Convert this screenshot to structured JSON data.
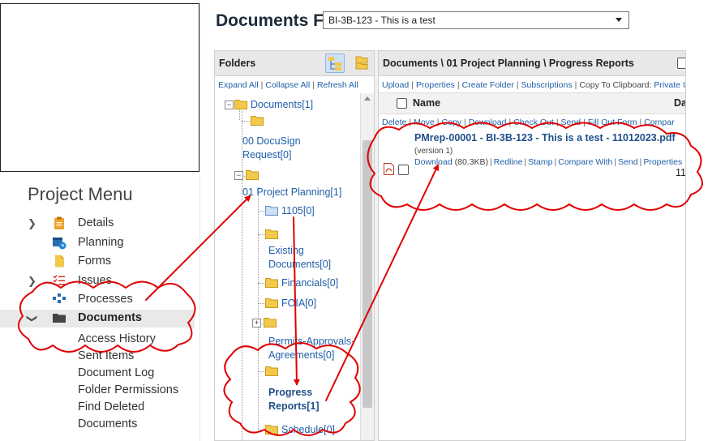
{
  "sidebar": {
    "title": "Project Menu",
    "items": [
      {
        "label": "Details",
        "has_chevron": true,
        "icon": "clipboard-icon"
      },
      {
        "label": "Planning",
        "has_chevron": false,
        "icon": "calendar-clock-icon"
      },
      {
        "label": "Forms",
        "has_chevron": false,
        "icon": "form-icon"
      },
      {
        "label": "Issues",
        "has_chevron": true,
        "icon": "checklist-icon"
      },
      {
        "label": "Processes",
        "has_chevron": false,
        "icon": "process-icon"
      },
      {
        "label": "Documents",
        "has_chevron": true,
        "icon": "folder-icon",
        "active": true
      }
    ],
    "sub_items": [
      "Access History",
      "Sent Items",
      "Document Log",
      "Folder Permissions",
      "Find Deleted",
      "Documents"
    ]
  },
  "header": {
    "documents_for_label": "Documents For",
    "project_select_value": "BI-3B-123 - This is a test"
  },
  "folders_pane": {
    "title": "Folders",
    "expand_all": "Expand All",
    "collapse_all": "Collapse All",
    "refresh_all": "Refresh All",
    "separator": "|",
    "tree": {
      "root": "Documents[1]",
      "docusign_line1": "00 DocuSign",
      "docusign_line2": "Request[0]",
      "project_planning": "01 Project Planning[1]",
      "f1105": "1105[0]",
      "existing_line1": "Existing",
      "existing_line2": "Documents[0]",
      "financials": "Financials[0]",
      "foia": "FOIA[0]",
      "permits_line1": "Permits-Approvals-",
      "permits_line2": "Agreements[0]",
      "progress_line1": "Progress",
      "progress_line2": "Reports[1]",
      "schedule": "Schedule[0]"
    }
  },
  "documents_pane": {
    "breadcrumb": "Documents \\ 01 Project Planning \\ Progress Reports",
    "toolbar1": {
      "upload": "Upload",
      "properties": "Properties",
      "create_folder": "Create Folder",
      "subscriptions": "Subscriptions",
      "copy_to_clipboard": "Copy To Clipboard:",
      "private": "Private U"
    },
    "columns": {
      "name": "Name",
      "date": "Da"
    },
    "toolbar2": {
      "delete": "Delete",
      "move": "Move",
      "copy": "Copy",
      "download": "Download",
      "check_out": "Check Out",
      "send": "Send",
      "fill_out_form": "Fill Out Form",
      "compare": "Compar"
    },
    "file": {
      "title": "PMrep-00001 - BI-3B-123 - This is a test - 11012023.pdf",
      "version": "(version 1)",
      "download": "Download",
      "size": "(80.3KB)",
      "redline": "Redline",
      "stamp": "Stamp",
      "compare_with": "Compare With",
      "send": "Send",
      "properties": "Properties",
      "date": "11."
    }
  },
  "colors": {
    "link": "#1f5fa8",
    "annotation": "#e00000",
    "folder_yellow": "#f2c94c",
    "header_bg": "#e8e8e8"
  }
}
